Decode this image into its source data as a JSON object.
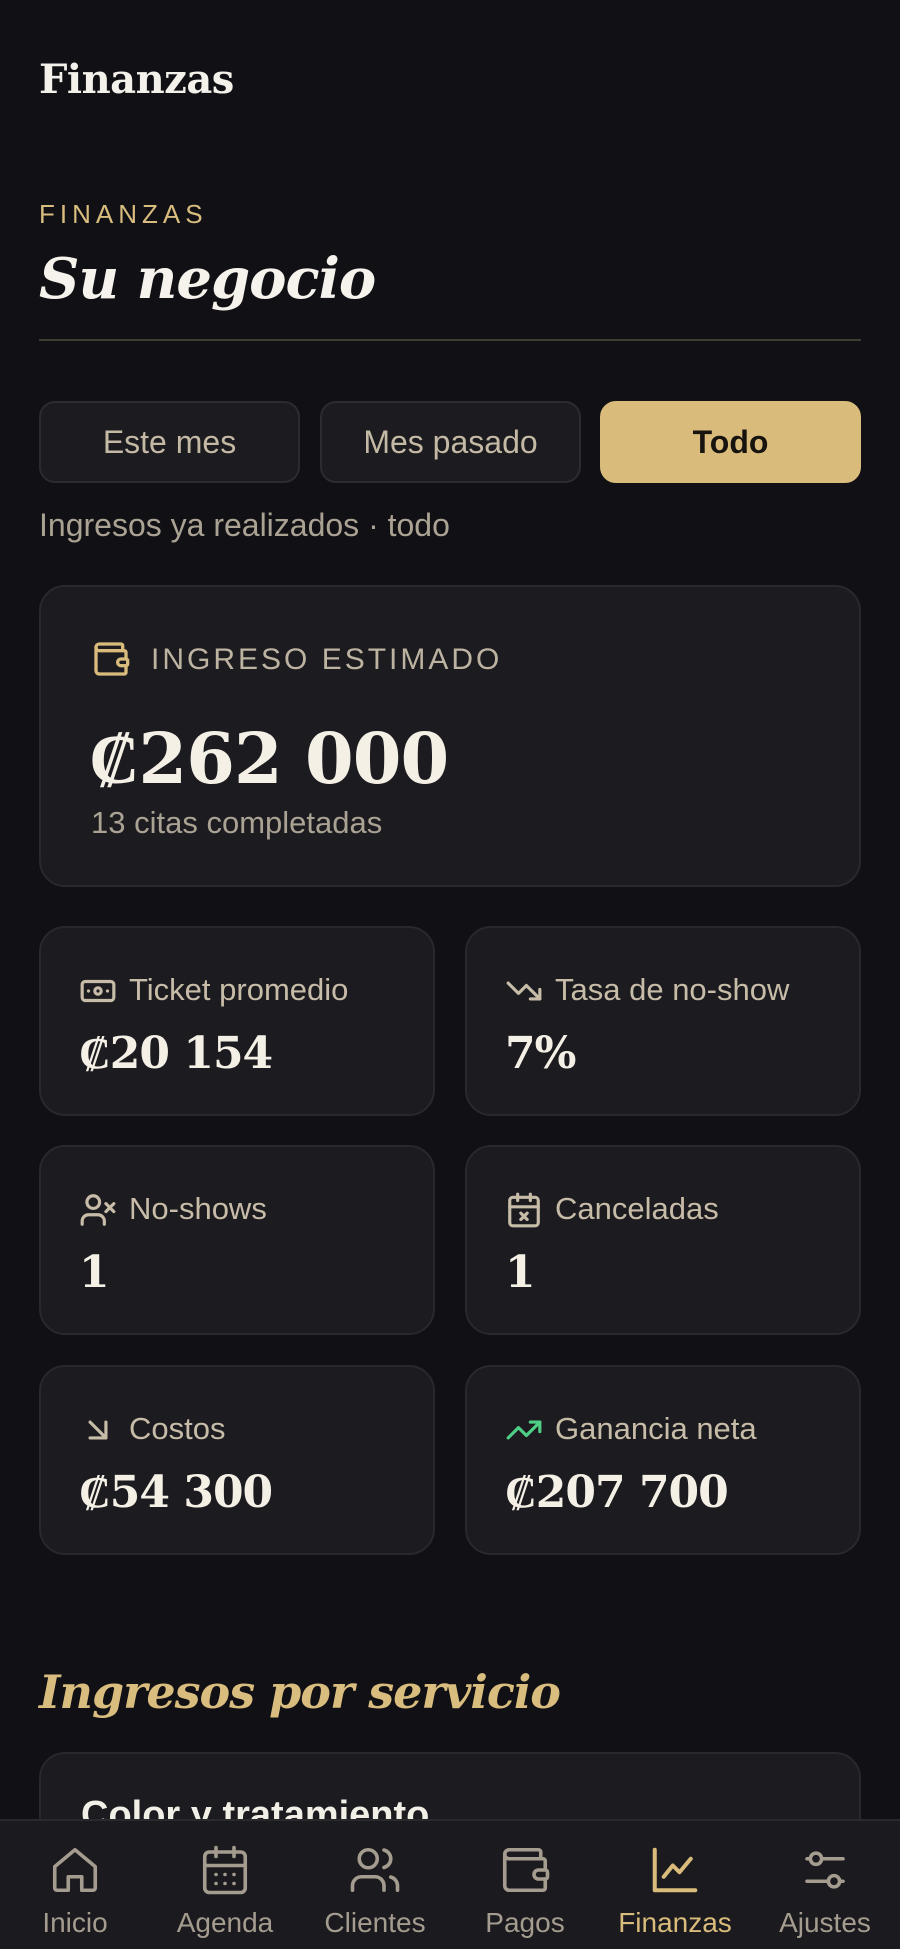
{
  "header": {
    "title": "Finanzas"
  },
  "hero": {
    "eyebrow": "FINANZAS",
    "title": "Su negocio"
  },
  "periods": [
    {
      "label": "Este mes",
      "active": false
    },
    {
      "label": "Mes pasado",
      "active": false
    },
    {
      "label": "Todo",
      "active": true
    }
  ],
  "caption": "Ingresos ya realizados · todo",
  "estimated": {
    "label": "INGRESO ESTIMADO",
    "value": "₡262 000",
    "sub": "13 citas completadas",
    "icon": "wallet-icon"
  },
  "stats": [
    {
      "label": "Ticket promedio",
      "value": "₡20 154",
      "icon": "banknote-icon"
    },
    {
      "label": "Tasa de no-show",
      "value": "7%",
      "icon": "trending-down-icon"
    },
    {
      "label": "No-shows",
      "value": "1",
      "icon": "user-x-icon"
    },
    {
      "label": "Canceladas",
      "value": "1",
      "icon": "calendar-x-icon"
    },
    {
      "label": "Costos",
      "value": "₡54 300",
      "icon": "arrow-down-right-icon"
    },
    {
      "label": "Ganancia neta",
      "value": "₡207 700",
      "icon": "trending-up-icon"
    }
  ],
  "services": {
    "title": "Ingresos por servicio",
    "items": [
      {
        "name": "Color y tratamiento"
      }
    ]
  },
  "nav": [
    {
      "label": "Inicio",
      "icon": "home-icon",
      "active": false
    },
    {
      "label": "Agenda",
      "icon": "calendar-icon",
      "active": false
    },
    {
      "label": "Clientes",
      "icon": "users-icon",
      "active": false
    },
    {
      "label": "Pagos",
      "icon": "wallet-icon",
      "active": false
    },
    {
      "label": "Finanzas",
      "icon": "chart-icon",
      "active": true
    },
    {
      "label": "Ajustes",
      "icon": "sliders-icon",
      "active": false
    }
  ],
  "colors": {
    "background": "#111015",
    "accent": "#d9bc7b",
    "card": "#1c1b20",
    "positive": "#4fcf86"
  }
}
